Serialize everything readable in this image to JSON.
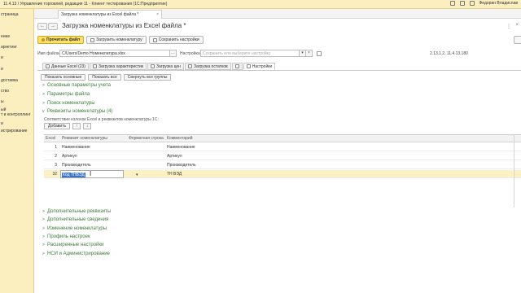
{
  "titlebar": {
    "title": "11.4.13 / Управление торговлей, редакция 11 - Клиент тестирования (1С:Предприятие)",
    "user": "Федорин Владислав"
  },
  "sidebar": {
    "items": [
      {
        "label": "страница"
      },
      {
        "label": "ение"
      },
      {
        "label": "аркетинг"
      },
      {
        "label": "и"
      },
      {
        "label": "и"
      },
      {
        "label": "доставка"
      },
      {
        "label": "ство"
      },
      {
        "label": "ы"
      },
      {
        "label": "ый"
      },
      {
        "label": "т и контроллинг"
      },
      {
        "label": "и"
      },
      {
        "label": "истрирование"
      }
    ]
  },
  "doc_tab": {
    "label": "Загрузка номенклатуры из Excel файла *",
    "close": "×"
  },
  "form": {
    "title": "Загрузка номенклатуры из Excel файла *",
    "back": "←",
    "forward": "→",
    "menu": "⋮",
    "close": "×"
  },
  "toolbar": {
    "read_file": "Прочитать файл",
    "load_nomenclature": "Загрузить номенклатуру",
    "save_settings": "Сохранить настройки"
  },
  "file_row": {
    "file_label": "Имя файла:",
    "file_value": "C/Users/Demo Номенклатура.xlsx",
    "settings_label": "Настройка:",
    "settings_placeholder": "Сохранить или выберите настройку",
    "version": "2.13.1.2, 11.4.13.180"
  },
  "inner_tabs": [
    {
      "label": "Данные Excel (23)",
      "active": false
    },
    {
      "label": "Загрузка характеристик",
      "active": false
    },
    {
      "label": "Загрузка цен",
      "active": false
    },
    {
      "label": "Загрузка остатков",
      "active": false
    },
    {
      "label": "",
      "active": false
    },
    {
      "label": "Настройки",
      "active": true
    }
  ],
  "view_buttons": {
    "show_main": "Показать основные",
    "show_all": "Показать все",
    "collapse_all": "Свернуть все группы"
  },
  "groups_top": [
    {
      "label": "Основные параметры учета"
    },
    {
      "label": "Параметры файла"
    },
    {
      "label": "Поиск номенклатуры"
    },
    {
      "label": "Реквизиты номенклатуры (4)",
      "expanded": true
    }
  ],
  "requisites": {
    "note": "Соответствие колонок Excel и реквизитов  номенклатуры 1С:",
    "add_button": "Добавить",
    "up": "↑",
    "down": "↓"
  },
  "table": {
    "headers": [
      "Excel",
      "Реквизит номенклатуры",
      "Форматная строка",
      "Комментарий"
    ],
    "rows": [
      {
        "excel": "1",
        "requisite": "Наименование",
        "format": "",
        "comment": "Наименование"
      },
      {
        "excel": "2",
        "requisite": "Артикул",
        "format": "",
        "comment": "Артикул"
      },
      {
        "excel": "3",
        "requisite": "Производитель",
        "format": "",
        "comment": "Производитель"
      },
      {
        "excel": "32",
        "requisite": "Код ТНВЭД",
        "format": "",
        "comment": "ТН ВЭД",
        "selected": true
      }
    ],
    "dropdown_icon": "▾"
  },
  "groups_bottom": [
    {
      "label": "Дополнительные реквизиты"
    },
    {
      "label": "Дополнительные сведения"
    },
    {
      "label": "Изменение номенклатуры"
    },
    {
      "label": "Профиль настроек"
    },
    {
      "label": "Расширенные настройки"
    },
    {
      "label": "НСИ и Администрирование"
    }
  ],
  "colors": {
    "sidebar_bg": "#fbeebf",
    "primary_button": "#fce165",
    "group_link": "#3c7a38",
    "selected_row": "#fbf1c4",
    "text_selection": "#3b73c4"
  }
}
